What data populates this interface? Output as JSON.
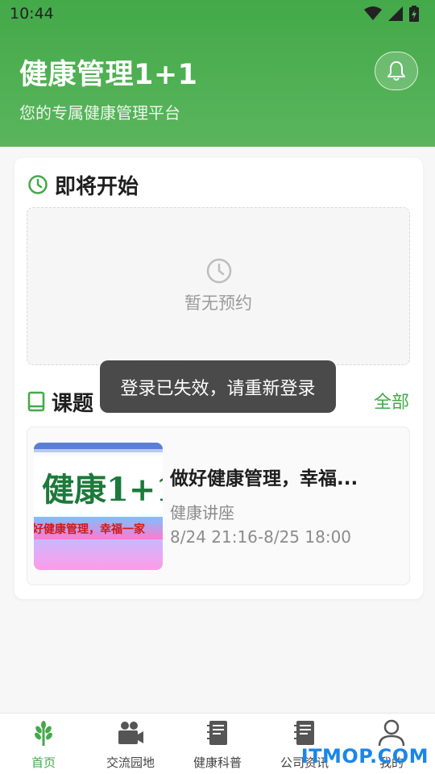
{
  "status_bar": {
    "time": "10:44"
  },
  "header": {
    "title": "健康管理1+1",
    "subtitle": "您的专属健康管理平台",
    "icons": {
      "bell": "bell-icon"
    }
  },
  "upcoming": {
    "title": "即将开始",
    "empty_text": "暂无预约",
    "icon": "clock-icon"
  },
  "courses": {
    "title": "课题",
    "view_all": "全部",
    "items": [
      {
        "title": "做好健康管理，幸福...",
        "category": "健康讲座",
        "time": "8/24 21:16-8/25 18:00",
        "thumbnail_text": "健康1+1",
        "thumbnail_banner": "好健康管理，幸福一家"
      }
    ]
  },
  "toast": {
    "message": "登录已失效，请重新登录"
  },
  "tabs": [
    {
      "label": "首页",
      "icon": "wheat-icon",
      "active": true
    },
    {
      "label": "交流园地",
      "icon": "video-camera-icon",
      "active": false
    },
    {
      "label": "健康科普",
      "icon": "notebook-icon",
      "active": false
    },
    {
      "label": "公司资讯",
      "icon": "notebook-icon",
      "active": false
    },
    {
      "label": "我的",
      "icon": "user-icon",
      "active": false
    }
  ],
  "watermark": "ITMOP.COM",
  "colors": {
    "primary": "#43a949",
    "toast_bg": "#404040"
  }
}
